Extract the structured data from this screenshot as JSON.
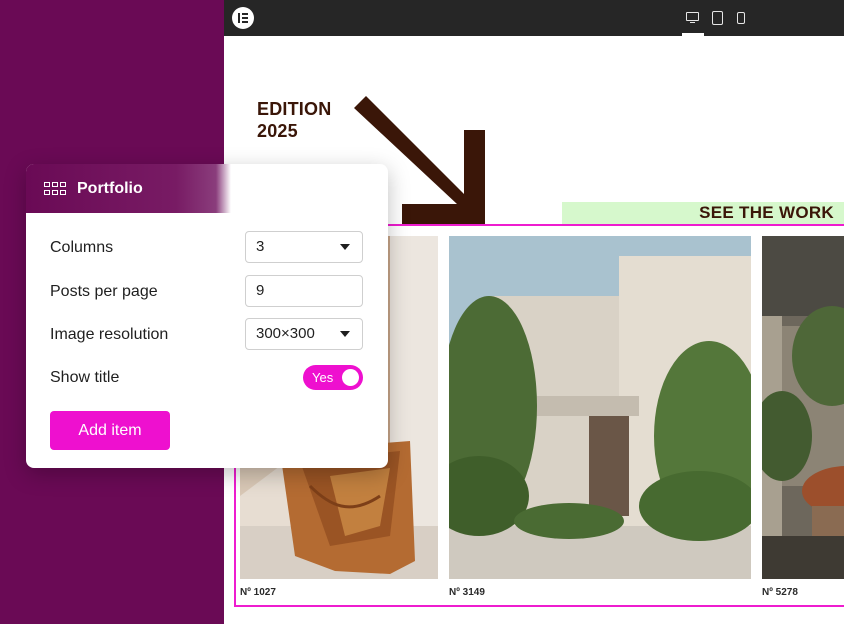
{
  "colors": {
    "background": "#6a0a55",
    "accent": "#ee10cf",
    "frame": "#ee1ccf",
    "banner": "#d6f8cc",
    "heading": "#3a1608",
    "topbar": "#262626"
  },
  "toolbar": {
    "logo_icon": "elementor-logo-icon",
    "devices": [
      "desktop-icon",
      "tablet-icon",
      "mobile-icon"
    ],
    "active_device": "desktop"
  },
  "canvas": {
    "edition_line1": "EDITION",
    "edition_line2": "2025",
    "banner": "SEE THE WORK",
    "gallery": [
      {
        "caption": "Nº 1027"
      },
      {
        "caption": "Nº 3149"
      },
      {
        "caption": "Nº 5278"
      }
    ]
  },
  "panel": {
    "title": "Portfolio",
    "title_icon": "grid-icon",
    "columns_label": "Columns",
    "columns_value": "3",
    "posts_label": "Posts per page",
    "posts_value": "9",
    "resolution_label": "Image resolution",
    "resolution_value": "300×300",
    "show_title_label": "Show title",
    "show_title_value": "Yes",
    "add_button": "Add item"
  }
}
